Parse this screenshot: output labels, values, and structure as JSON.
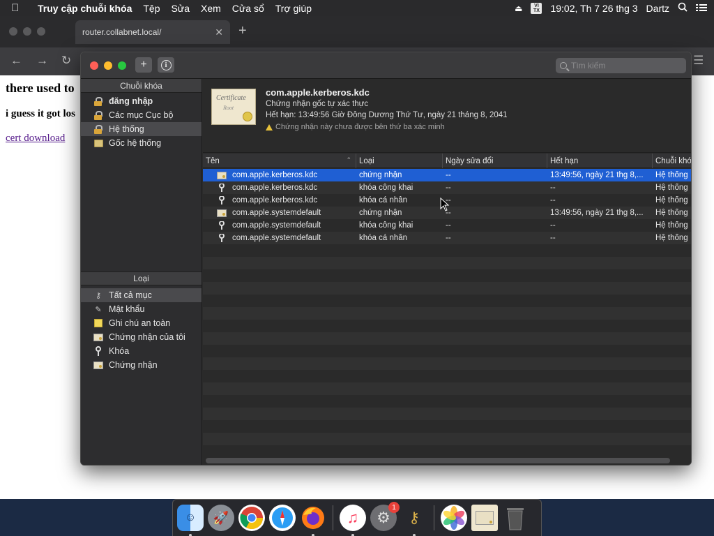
{
  "menubar": {
    "app_name": "Truy cập chuỗi khóa",
    "items": [
      "Tệp",
      "Sửa",
      "Xem",
      "Cửa sổ",
      "Trợ giúp"
    ],
    "input_source_top": "VI",
    "input_source_bottom": "TX",
    "clock": "19:02, Th 7 26 thg 3",
    "user": "Dartz"
  },
  "browser": {
    "tab_title": "router.collabnet.local/",
    "page_line1": "there used to",
    "page_line2": "i guess it got los",
    "page_link": "cert download"
  },
  "keychain": {
    "search_placeholder": "Tìm kiếm",
    "sidebar_keychains_header": "Chuỗi khóa",
    "keychains": [
      {
        "label": "đăng nhập",
        "icon": "lock-icon",
        "bold": true
      },
      {
        "label": "Các mục Cục bộ",
        "icon": "lock-icon"
      },
      {
        "label": "Hệ thống",
        "icon": "lock-icon",
        "selected": true
      },
      {
        "label": "Gốc hệ thống",
        "icon": "folder-icon"
      }
    ],
    "sidebar_category_header": "Loại",
    "categories": [
      {
        "label": "Tất cả mục",
        "icon": "keys-icon",
        "selected": true
      },
      {
        "label": "Mật khẩu",
        "icon": "pen-icon"
      },
      {
        "label": "Ghi chú an toàn",
        "icon": "note-icon"
      },
      {
        "label": "Chứng nhận của tôi",
        "icon": "certificate-icon"
      },
      {
        "label": "Khóa",
        "icon": "key-icon"
      },
      {
        "label": "Chứng nhận",
        "icon": "certificate-icon"
      }
    ],
    "detail": {
      "cert_image_text1": "Certificate",
      "cert_image_text2": "Root",
      "name": "com.apple.kerberos.kdc",
      "subtitle": "Chứng nhận gốc tự xác thực",
      "expires": "Hết hạn: 13:49:56 Giờ Đông Dương Thứ Tư, ngày 21 tháng 8, 2041",
      "warning": "Chứng nhận này chưa được bên thứ ba xác minh"
    },
    "columns": [
      "Tên",
      "Loại",
      "Ngày sửa đổi",
      "Hết hạn",
      "Chuỗi khóa"
    ],
    "rows": [
      {
        "name": "com.apple.kerberos.kdc",
        "icon": "certificate-icon",
        "kind": "chứng nhận",
        "modified": "--",
        "expires": "13:49:56, ngày 21 thg 8,...",
        "keychain": "Hệ thống",
        "selected": true
      },
      {
        "name": "com.apple.kerberos.kdc",
        "icon": "key-icon",
        "kind": "khóa công khai",
        "modified": "--",
        "expires": "--",
        "keychain": "Hệ thống"
      },
      {
        "name": "com.apple.kerberos.kdc",
        "icon": "key-icon",
        "kind": "khóa cá nhân",
        "modified": "--",
        "expires": "--",
        "keychain": "Hệ thống"
      },
      {
        "name": "com.apple.systemdefault",
        "icon": "certificate-icon",
        "kind": "chứng nhận",
        "modified": "--",
        "expires": "13:49:56, ngày 21 thg 8,...",
        "keychain": "Hệ thống"
      },
      {
        "name": "com.apple.systemdefault",
        "icon": "key-icon",
        "kind": "khóa công khai",
        "modified": "--",
        "expires": "--",
        "keychain": "Hệ thống"
      },
      {
        "name": "com.apple.systemdefault",
        "icon": "key-icon",
        "kind": "khóa cá nhân",
        "modified": "--",
        "expires": "--",
        "keychain": "Hệ thống"
      }
    ]
  },
  "dock": {
    "apps": [
      "finder-icon",
      "launchpad-icon",
      "chrome-icon",
      "safari-icon",
      "firefox-icon",
      "music-icon",
      "system-preferences-icon",
      "keychain-access-icon",
      "photos-icon",
      "certificate-assistant-icon",
      "trash-icon"
    ],
    "system_preferences_badge": "1"
  }
}
